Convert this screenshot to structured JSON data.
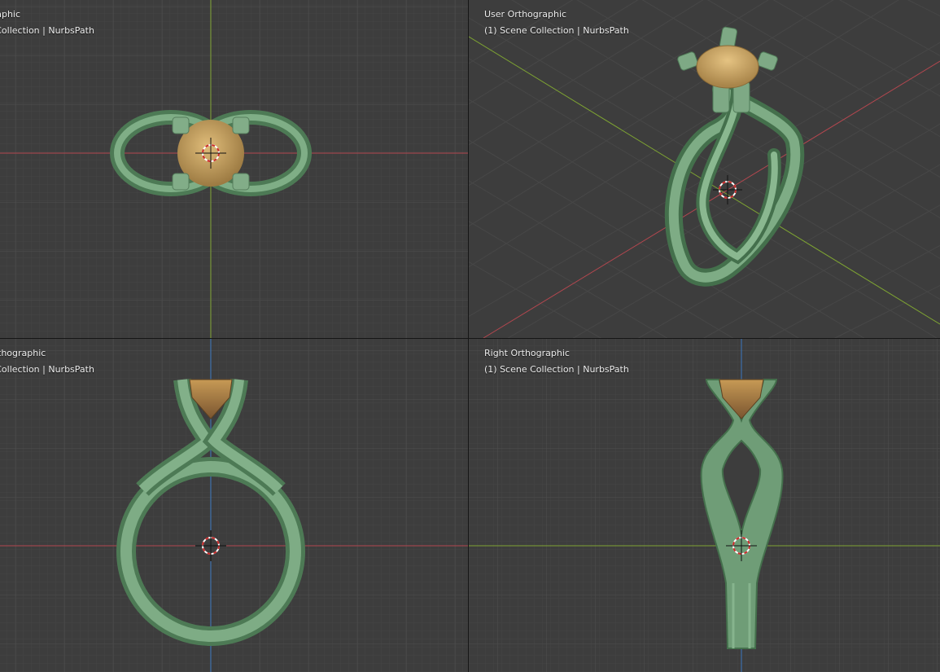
{
  "viewports": {
    "top_left": {
      "view_name": "ographic",
      "collection": "ne Collection | NurbsPath"
    },
    "top_right": {
      "view_name": "User Orthographic",
      "collection": "(1) Scene Collection | NurbsPath"
    },
    "bottom_left": {
      "view_name": "thographic",
      "collection": "ne Collection | NurbsPath"
    },
    "bottom_right": {
      "view_name": "Right Orthographic",
      "collection": "(1) Scene Collection | NurbsPath"
    }
  },
  "colors": {
    "viewport_bg": "#3d3d3d",
    "ring": "#6b9a72",
    "gem": "#c4a060",
    "x_axis": "#b3474f",
    "y_axis": "#7ea432",
    "z_axis": "#3a78c0"
  }
}
